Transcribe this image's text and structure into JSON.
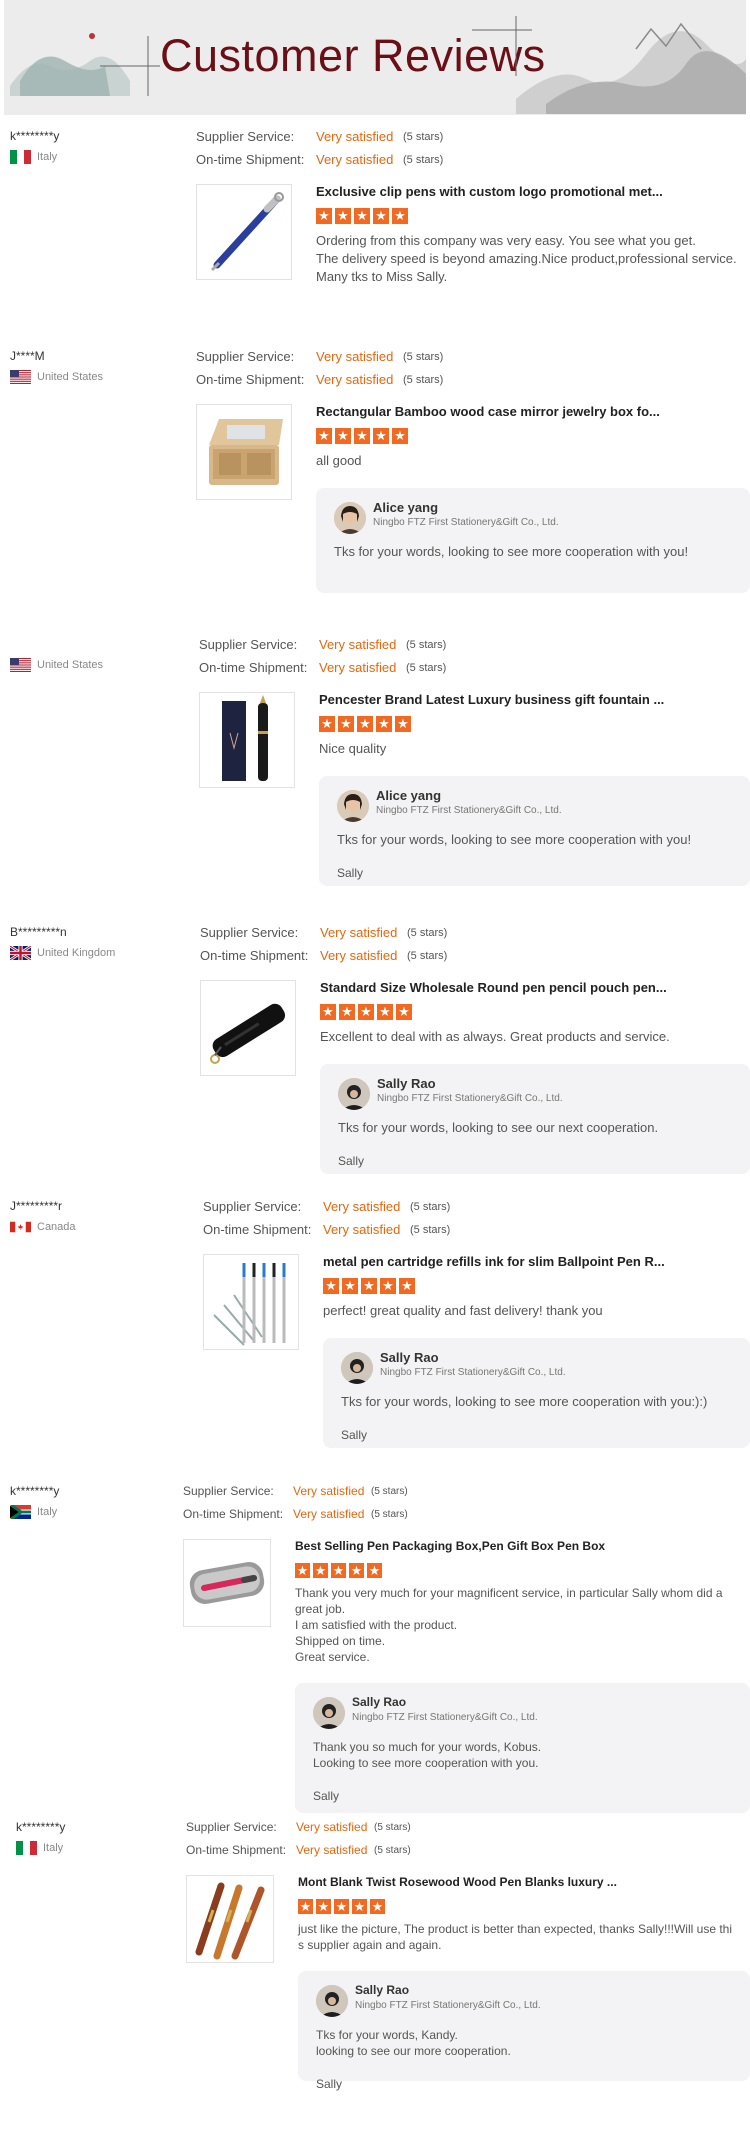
{
  "banner": {
    "title": "Customer Reviews"
  },
  "reviews": [
    {
      "name": "k********y",
      "country": "Italy",
      "flag": "italy-flag-icon",
      "supplier_label": "Supplier Service:",
      "supplier_value": "Very satisfied",
      "supplier_stars": "(5 stars)",
      "shipment_label": "On-time Shipment:",
      "shipment_value": "Very satisfied",
      "shipment_stars": "(5 stars)",
      "product_title": "Exclusive clip pens with custom logo promotional met...",
      "product_icon": "blue-pen-icon",
      "rating": 5,
      "text": "Ordering from this company was very easy. You see what you get.\nThe delivery speed is beyond amazing.Nice product,professional service.\nMany tks to Miss Sally.",
      "reply": null
    },
    {
      "name": "J****M",
      "country": "United States",
      "flag": "usa-flag-icon",
      "supplier_label": "Supplier Service:",
      "supplier_value": "Very satisfied",
      "supplier_stars": "(5 stars)",
      "shipment_label": "On-time Shipment:",
      "shipment_value": "Very satisfied",
      "shipment_stars": "(5 stars)",
      "product_title": "Rectangular Bamboo wood case mirror jewelry box fo...",
      "product_icon": "bamboo-box-icon",
      "rating": 5,
      "text": "all good",
      "reply": {
        "name": "Alice yang",
        "company": "Ningbo FTZ First Stationery&Gift Co., Ltd.",
        "text": "Tks for your words, looking to see more cooperation with you!",
        "sign": ""
      }
    },
    {
      "name": "",
      "country": "United States",
      "flag": "usa-flag-icon",
      "supplier_label": "Supplier Service:",
      "supplier_value": "Very satisfied",
      "supplier_stars": "(5 stars)",
      "shipment_label": "On-time Shipment:",
      "shipment_value": "Very satisfied",
      "shipment_stars": "(5 stars)",
      "product_title": "Pencester Brand Latest Luxury business gift fountain ...",
      "product_icon": "fountain-pen-box-icon",
      "rating": 5,
      "text": "Nice quality",
      "reply": {
        "name": "Alice yang",
        "company": "Ningbo FTZ First Stationery&Gift Co., Ltd.",
        "text": "Tks for your words, looking to see more cooperation with you!",
        "sign": "Sally"
      }
    },
    {
      "name": "B*********n",
      "country": "United Kingdom",
      "flag": "uk-flag-icon",
      "supplier_label": "Supplier Service:",
      "supplier_value": "Very satisfied",
      "supplier_stars": "(5 stars)",
      "shipment_label": "On-time Shipment:",
      "shipment_value": "Very satisfied",
      "shipment_stars": "(5 stars)",
      "product_title": "Standard Size Wholesale Round pen pencil pouch pen...",
      "product_icon": "pen-pouch-icon",
      "rating": 5,
      "text": "Excellent to deal with as always. Great products and service.",
      "reply": {
        "name": "Sally Rao",
        "company": "Ningbo FTZ First Stationery&Gift Co., Ltd.",
        "text": "Tks for your words, looking to see our next cooperation.",
        "sign": "Sally"
      }
    },
    {
      "name": "J*********r",
      "country": "Canada",
      "flag": "canada-flag-icon",
      "supplier_label": "Supplier Service:",
      "supplier_value": "Very satisfied",
      "supplier_stars": "(5 stars)",
      "shipment_label": "On-time Shipment:",
      "shipment_value": "Very satisfied",
      "shipment_stars": "(5 stars)",
      "product_title": "metal pen cartridge refills ink for slim Ballpoint Pen R...",
      "product_icon": "pen-refills-icon",
      "rating": 5,
      "text": "perfect! great quality and fast delivery!  thank you",
      "reply": {
        "name": "Sally Rao",
        "company": "Ningbo FTZ First Stationery&Gift Co., Ltd.",
        "text": "Tks for your words, looking to see more cooperation with you:):)",
        "sign": "Sally"
      }
    },
    {
      "name": "k********y",
      "country": "Italy",
      "flag": "south-africa-flag-icon",
      "supplier_label": "Supplier Service:",
      "supplier_value": "Very satisfied",
      "supplier_stars": "(5 stars)",
      "shipment_label": "On-time Shipment:",
      "shipment_value": "Very satisfied",
      "shipment_stars": "(5 stars)",
      "product_title": "Best Selling Pen Packaging Box,Pen Gift Box Pen Box",
      "product_icon": "pen-tin-box-icon",
      "rating": 5,
      "text": "Thank you very much for your magnificent service, in particular Sally whom did a great job.\nI am satisfied with the product.\nShipped on time.\nGreat service.",
      "reply": {
        "name": "Sally Rao",
        "company": "Ningbo FTZ First Stationery&Gift Co., Ltd.",
        "text": "Thank you so much for your words, Kobus.\nLooking to see more cooperation with you.",
        "sign": "Sally"
      }
    },
    {
      "name": "k********y",
      "country": "Italy",
      "flag": "italy-flag-icon",
      "supplier_label": "Supplier Service:",
      "supplier_value": "Very satisfied",
      "supplier_stars": "(5 stars)",
      "shipment_label": "On-time Shipment:",
      "shipment_value": "Very satisfied",
      "shipment_stars": "(5 stars)",
      "product_title": "Mont Blank Twist Rosewood Wood Pen Blanks luxury ...",
      "product_icon": "wood-pens-icon",
      "rating": 5,
      "text": "just like the picture, The product is better than expected, thanks Sally!!!Will use thi s supplier again and again.",
      "reply": {
        "name": "Sally Rao",
        "company": "Ningbo FTZ First Stationery&Gift Co., Ltd.",
        "text": "Tks for your words, Kandy.\nlooking to see our more cooperation.",
        "sign": "Sally"
      }
    }
  ]
}
